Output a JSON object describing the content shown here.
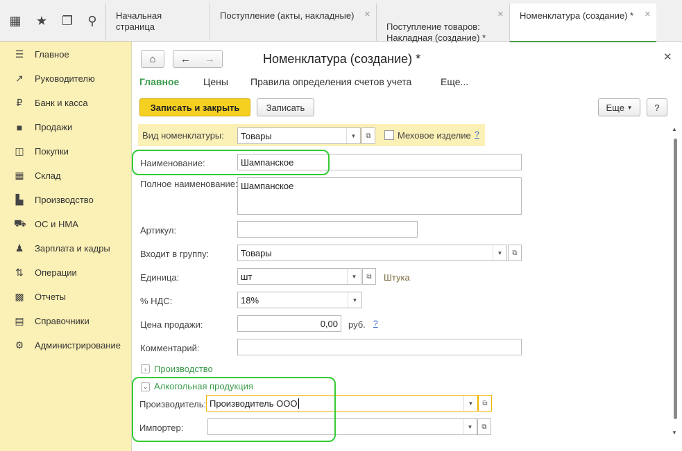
{
  "toolbar": {
    "icons": [
      "apps-grid-icon",
      "favorites-star-icon",
      "history-icon",
      "search-icon"
    ]
  },
  "tabs": [
    {
      "label": "Начальная страница"
    },
    {
      "label": "Поступление (акты, накладные)"
    },
    {
      "label": "Поступление товаров:\nНакладная (создание) *"
    },
    {
      "label": "Номенклатура (создание) *"
    }
  ],
  "sidebar": {
    "items": [
      {
        "label": "Главное",
        "icon": "menu-icon"
      },
      {
        "label": "Руководителю",
        "icon": "trend-icon"
      },
      {
        "label": "Банк и касса",
        "icon": "ruble-icon"
      },
      {
        "label": "Продажи",
        "icon": "shopping-bag-icon"
      },
      {
        "label": "Покупки",
        "icon": "cart-icon"
      },
      {
        "label": "Склад",
        "icon": "warehouse-icon"
      },
      {
        "label": "Производство",
        "icon": "factory-icon"
      },
      {
        "label": "ОС и НМА",
        "icon": "truck-icon"
      },
      {
        "label": "Зарплата и кадры",
        "icon": "people-icon"
      },
      {
        "label": "Операции",
        "icon": "operations-icon"
      },
      {
        "label": "Отчеты",
        "icon": "chart-icon"
      },
      {
        "label": "Справочники",
        "icon": "books-icon"
      },
      {
        "label": "Администрирование",
        "icon": "gear-icon"
      }
    ]
  },
  "form": {
    "title": "Номенклатура (создание) *",
    "tabs": [
      "Главное",
      "Цены",
      "Правила определения счетов учета",
      "Еще..."
    ],
    "buttons": {
      "save_close": "Записать и закрыть",
      "save": "Записать",
      "more": "Еще",
      "help": "?"
    },
    "kind_label": "Вид номенклатуры:",
    "kind_value": "Товары",
    "fur_label": "Меховое изделие",
    "fur_help": "?",
    "name_label": "Наименование:",
    "name_value": "Шампанское",
    "fullname_label": "Полное наименование:",
    "fullname_value": "Шампанское",
    "article_label": "Артикул:",
    "article_value": "",
    "group_label": "Входит в группу:",
    "group_value": "Товары",
    "unit_label": "Единица:",
    "unit_value": "шт",
    "unit_hint": "Штука",
    "vat_label": "% НДС:",
    "vat_value": "18%",
    "price_label": "Цена продажи:",
    "price_value": "0,00",
    "price_currency": "руб.",
    "price_help": "?",
    "comment_label": "Комментарий:",
    "comment_value": "",
    "production_group": "Производство",
    "alcohol_group": "Алкогольная продукция",
    "producer_label": "Производитель:",
    "producer_value": "Производитель ООО",
    "importer_label": "Импортер:",
    "importer_value": ""
  },
  "colors": {
    "sidebar_bg": "#fbf0b5",
    "accent_green": "#3a9a4a",
    "primary_button": "#f6d021",
    "highlight": "#33cc33"
  }
}
